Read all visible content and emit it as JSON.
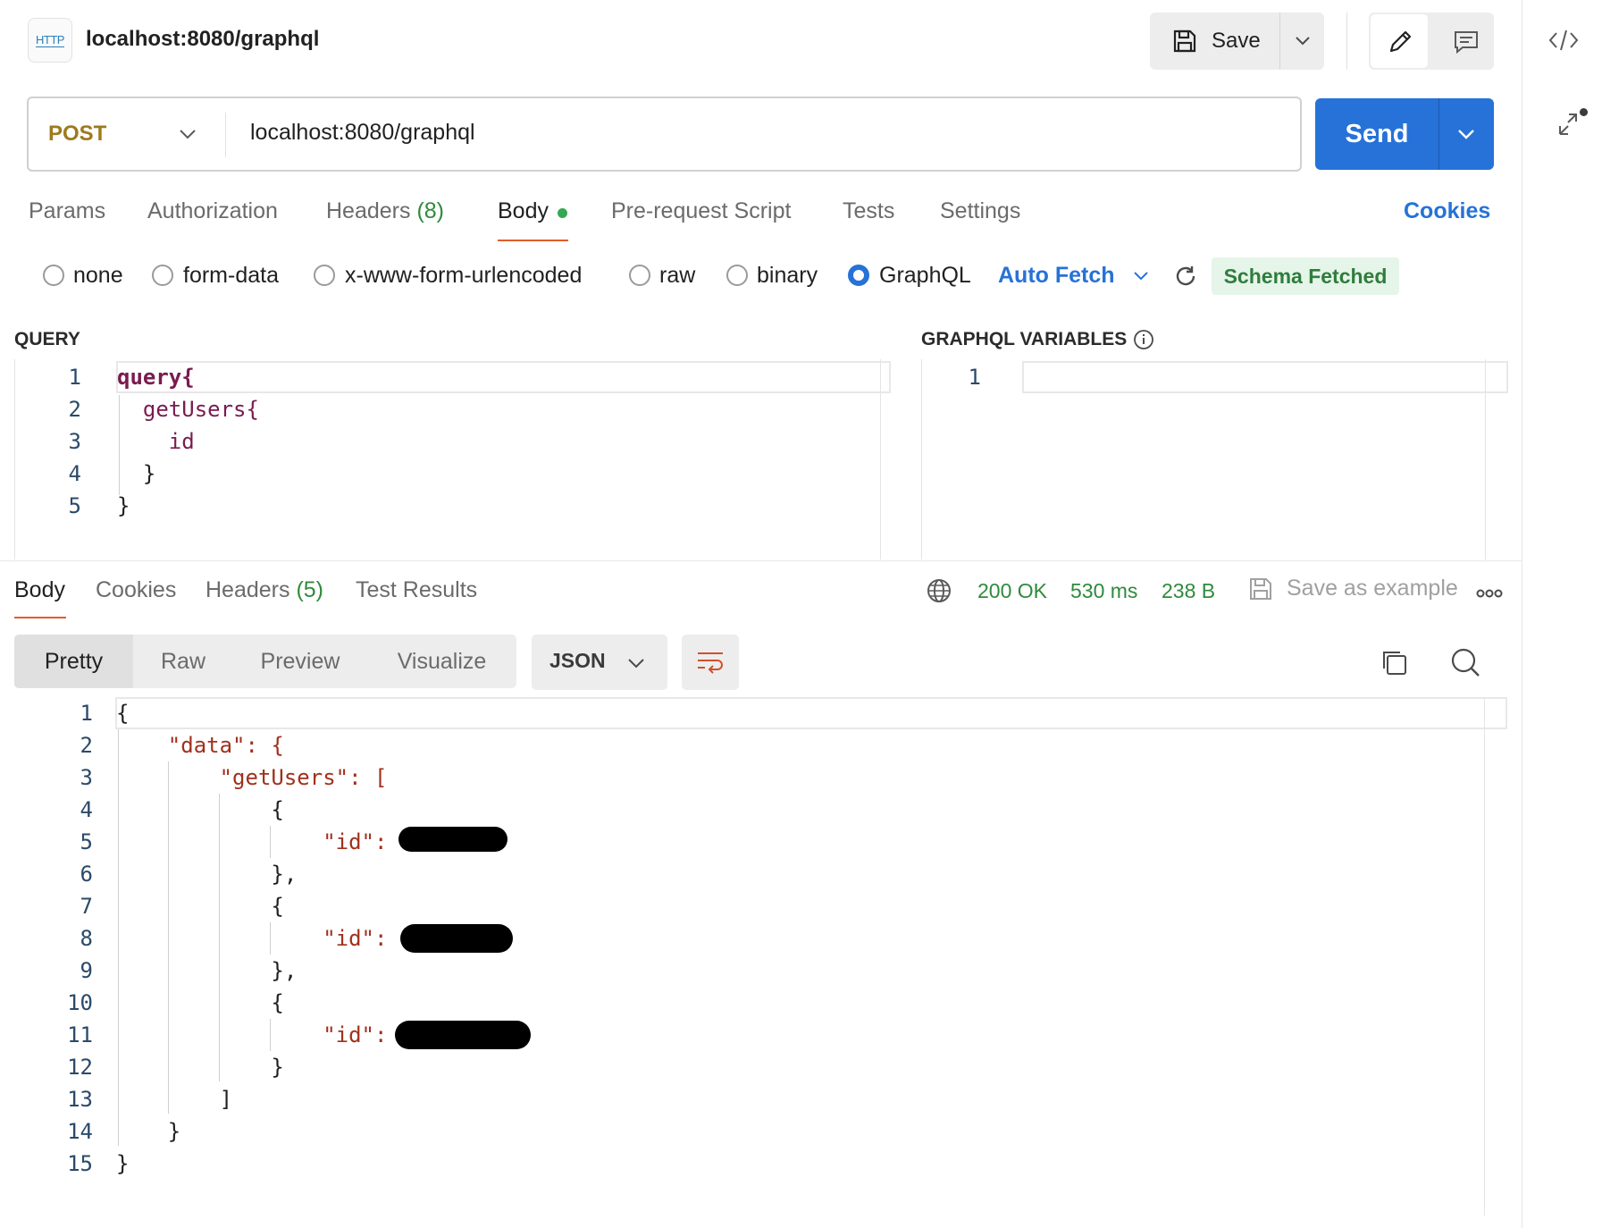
{
  "header": {
    "icon_text": "HTTP",
    "title": "localhost:8080/graphql",
    "save_label": "Save"
  },
  "request": {
    "method": "POST",
    "url": "localhost:8080/graphql",
    "send_label": "Send"
  },
  "request_tabs": [
    {
      "label": "Params"
    },
    {
      "label": "Authorization"
    },
    {
      "label": "Headers",
      "count": "(8)"
    },
    {
      "label": "Body"
    },
    {
      "label": "Pre-request Script"
    },
    {
      "label": "Tests"
    },
    {
      "label": "Settings"
    }
  ],
  "cookies_link": "Cookies",
  "body_types": [
    {
      "label": "none",
      "checked": false
    },
    {
      "label": "form-data",
      "checked": false
    },
    {
      "label": "x-www-form-urlencoded",
      "checked": false
    },
    {
      "label": "raw",
      "checked": false
    },
    {
      "label": "binary",
      "checked": false
    },
    {
      "label": "GraphQL",
      "checked": true
    }
  ],
  "auto_fetch": "Auto Fetch",
  "schema_status": "Schema Fetched",
  "query": {
    "label": "QUERY",
    "line_numbers": [
      "1",
      "2",
      "3",
      "4",
      "5"
    ],
    "lines": [
      "query{",
      "  getUsers{",
      "    id",
      "  }",
      "}"
    ]
  },
  "variables": {
    "label": "GRAPHQL VARIABLES",
    "line_numbers": [
      "1"
    ]
  },
  "response_tabs": [
    {
      "label": "Body"
    },
    {
      "label": "Cookies"
    },
    {
      "label": "Headers",
      "count": "(5)"
    },
    {
      "label": "Test Results"
    }
  ],
  "response_meta": {
    "status": "200 OK",
    "time": "530 ms",
    "size": "238 B",
    "save_example": "Save as example"
  },
  "view_modes": [
    "Pretty",
    "Raw",
    "Preview",
    "Visualize"
  ],
  "format": "JSON",
  "response_body": {
    "line_numbers": [
      "1",
      "2",
      "3",
      "4",
      "5",
      "6",
      "7",
      "8",
      "9",
      "10",
      "11",
      "12",
      "13",
      "14",
      "15"
    ],
    "lines": [
      "{",
      "    \"data\": {",
      "        \"getUsers\": [",
      "            {",
      "                \"id\": ",
      "            },",
      "            {",
      "                \"id\": ",
      "            },",
      "            {",
      "                \"id\": ",
      "            }",
      "        ]",
      "    }",
      "}"
    ]
  },
  "colors": {
    "accent": "#2672d8",
    "method": "#9e7a1d",
    "success": "#2f8a3c",
    "tab_underline": "#e05d2a"
  }
}
